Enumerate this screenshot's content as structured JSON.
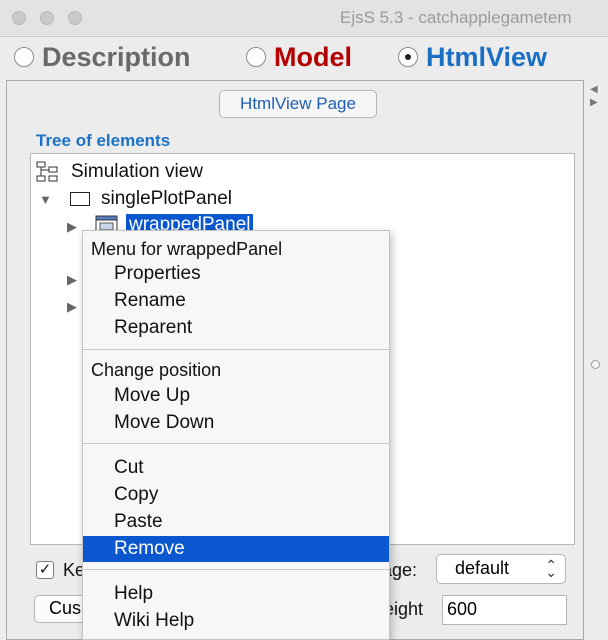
{
  "window": {
    "title": "EjsS 5.3 - catchapplegametem"
  },
  "modes": [
    {
      "label": "Description",
      "color": "#6a6a6a",
      "selected": false
    },
    {
      "label": "Model",
      "color": "#b30000",
      "selected": false
    },
    {
      "label": "HtmlView",
      "color": "#1a6fc4",
      "selected": true
    }
  ],
  "page_button": "HtmlView Page",
  "tree": {
    "label": "Tree of elements",
    "root": "Simulation view",
    "child": "singlePlotPanel",
    "selected": "wrappedPanel"
  },
  "bottom": {
    "keep_label": "Ke",
    "keep_checked": true,
    "image_label": "age:",
    "image_value": "default",
    "custom_button": "Cus",
    "height_label": "eight",
    "height_value": "600"
  },
  "context_menu": {
    "header": "Menu for wrappedPanel",
    "group1": [
      "Properties",
      "Rename",
      "Reparent"
    ],
    "position_header": "Change position",
    "group2": [
      "Move Up",
      "Move Down"
    ],
    "group3": [
      "Cut",
      "Copy",
      "Paste",
      "Remove"
    ],
    "highlighted": "Remove",
    "group4": [
      "Help",
      "Wiki Help"
    ]
  },
  "colors": {
    "selection": "#0b57d0",
    "section_label": "#1a73c8"
  }
}
